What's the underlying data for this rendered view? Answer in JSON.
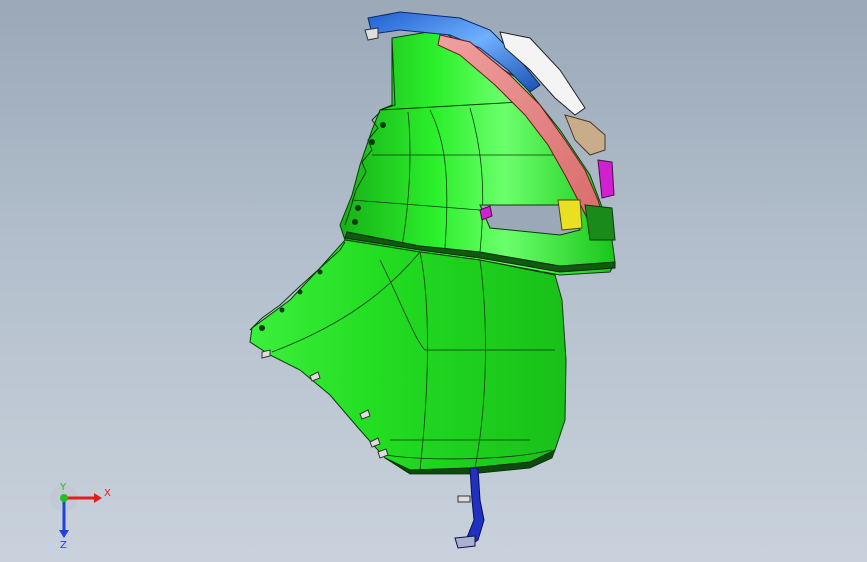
{
  "viewport": {
    "background_top": "#9aa8b8",
    "background_bottom": "#c9d2dc"
  },
  "model": {
    "parts": [
      {
        "name": "bumper-cover",
        "color": "#1fe01f"
      },
      {
        "name": "upper-bracket",
        "color": "#2f7fe0"
      },
      {
        "name": "lamp-lens",
        "color": "#f2f2f2"
      },
      {
        "name": "reinforcement-rail",
        "color": "#e88080"
      },
      {
        "name": "tan-clip",
        "color": "#c9ad8a"
      },
      {
        "name": "magenta-clip",
        "color": "#d020d0"
      },
      {
        "name": "yellow-clip",
        "color": "#e8e020"
      },
      {
        "name": "lower-bracket",
        "color": "#2030c0"
      }
    ]
  },
  "triad": {
    "x_label": "X",
    "y_label": "Y",
    "z_label": "Z",
    "x_color": "#e02020",
    "y_color": "#20c020",
    "z_color": "#2040e0"
  }
}
